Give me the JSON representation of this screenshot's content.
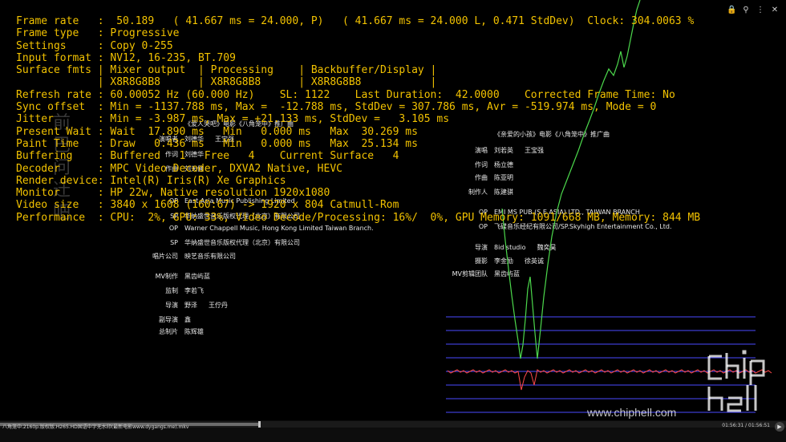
{
  "stats": [
    "Frame rate   :  50.189   ( 41.667 ms = 24.000, P)   ( 41.667 ms = 24.000 L, 0.471 StdDev)  Clock: 304.0063 %",
    "Frame type   : Progressive",
    "Settings     : Copy 0-255",
    "Input format : NV12, 16-235, BT.709",
    "Surface fmts | Mixer output  | Processing    | Backbuffer/Display |",
    "             | X8R8G8B8      | X8R8G8B8      | X8R8G8B8           |",
    "Refresh rate : 60.00052 Hz (60.000 Hz)    SL: 1122    Last Duration:  42.0000    Corrected Frame Time: No",
    "Sync offset  : Min = -1137.788 ms, Max =  -12.788 ms, StdDev = 307.786 ms, Avr = -519.974 ms, Mode = 0",
    "Jitter       : Min = -3.987 ms, Max = +21.133 ms, StdDev =   3.105 ms",
    "Present Wait : Wait  17.890 ms   Min   0.000 ms   Max  30.269 ms",
    "Paint Time   : Draw   0.436 ms   Min   0.000 ms   Max  25.134 ms",
    "Buffering    : Buffered   1   Free   4    Current Surface   4",
    "Decoder      : MPC Video Decoder, DXVA2 Native, HEVC",
    "Render device: Intel(R) Iris(R) Xe Graphics",
    "Monitor      : HP 22w, Native resolution 1920x1080",
    "Video size   : 3840 x 1608 (160:67) -> 1920 x 804 Catmull-Rom",
    "Performance  : CPU:  2%, GPU: 33%, Video Decode/Processing: 16%/  0%, GPU Memory: 1091/668 MB, Memory: 844 MB"
  ],
  "ghost_title": "前 巴 问 迁 吧",
  "credits_left": [
    {
      "role": "",
      "name": "《爱人哭吧》电影《八角笼中》推广曲",
      "name2": ""
    },
    {
      "role": "演唱者",
      "name": "刘德华",
      "name2": "王宝强"
    },
    {
      "role": "作词",
      "name": "刘德华",
      "name2": ""
    },
    {
      "role": "作曲",
      "name": "刘天健",
      "name2": ""
    },
    {
      "role": "OP",
      "name": "East Asia Music Publishing Limited",
      "name2": ""
    },
    {
      "role": "SP",
      "name": "华纳盛世音乐版权代理（北京）有限公司",
      "name2": ""
    },
    {
      "role": "OP",
      "name": "Warner Chappell Music, Hong Kong Limited Taiwan Branch.",
      "name2": ""
    },
    {
      "role": "SP",
      "name": "华纳盛世音乐版权代理（北京）有限公司",
      "name2": ""
    },
    {
      "role": "唱片公司",
      "name": "映艺音乐有限公司",
      "name2": ""
    },
    {
      "role": "MV制作",
      "name": "黑齿屿蓝",
      "name2": ""
    },
    {
      "role": "监制",
      "name": "李若飞",
      "name2": ""
    },
    {
      "role": "导演",
      "name": "野泽",
      "name2": "王佇丹"
    },
    {
      "role": "副导演",
      "name": "鑫",
      "name2": ""
    },
    {
      "role": "总制片",
      "name": "陈辉雄",
      "name2": ""
    }
  ],
  "credits_right": [
    {
      "role": "",
      "name": "《亲爱的小孩》电影《八角笼中》推广曲",
      "name2": ""
    },
    {
      "role": "演唱",
      "name": "刘若英",
      "name2": "王宝强"
    },
    {
      "role": "作词",
      "name": "杨立德",
      "name2": ""
    },
    {
      "role": "作曲",
      "name": "陈亚明",
      "name2": ""
    },
    {
      "role": "制作人",
      "name": "陈建骐",
      "name2": ""
    },
    {
      "role": "OP",
      "name": "EMI MS PUB (S.E.ASIA) LTD., TAIWAN BRANCH",
      "name2": ""
    },
    {
      "role": "OP",
      "name": "飞碟音乐经纪有限公司/SP.Skyhigh Entertainment Co., Ltd.",
      "name2": ""
    },
    {
      "role": "导演",
      "name": "8id studio",
      "name2": "魏奕昊"
    },
    {
      "role": "摄影",
      "name": "李金励",
      "name2": "徐英诚"
    },
    {
      "role": "MV剪辑团队",
      "name": "黑齿屿蓝",
      "name2": ""
    }
  ],
  "watermark": {
    "url": "www.chiphell.com"
  },
  "player": {
    "filename": "八角笼中.2160p.版权版.H265.HD国语中字无水印(最新电影www.dygangs.me).mkv",
    "time": "01:56:31 / 01:56:51",
    "seek_progress": 0.33,
    "play_symbol": "▶"
  },
  "window_controls": [
    {
      "name": "lock-icon",
      "glyph": "🔒"
    },
    {
      "name": "pin-icon",
      "glyph": "⚲"
    },
    {
      "name": "settings-icon",
      "glyph": "⋮"
    },
    {
      "name": "close-icon",
      "glyph": "✕"
    }
  ],
  "colors": {
    "stats_text": "#f2c200",
    "graph_green": "#4cd84c",
    "graph_grid": "#4a4aff",
    "graph_red": "#ff4a4a"
  }
}
